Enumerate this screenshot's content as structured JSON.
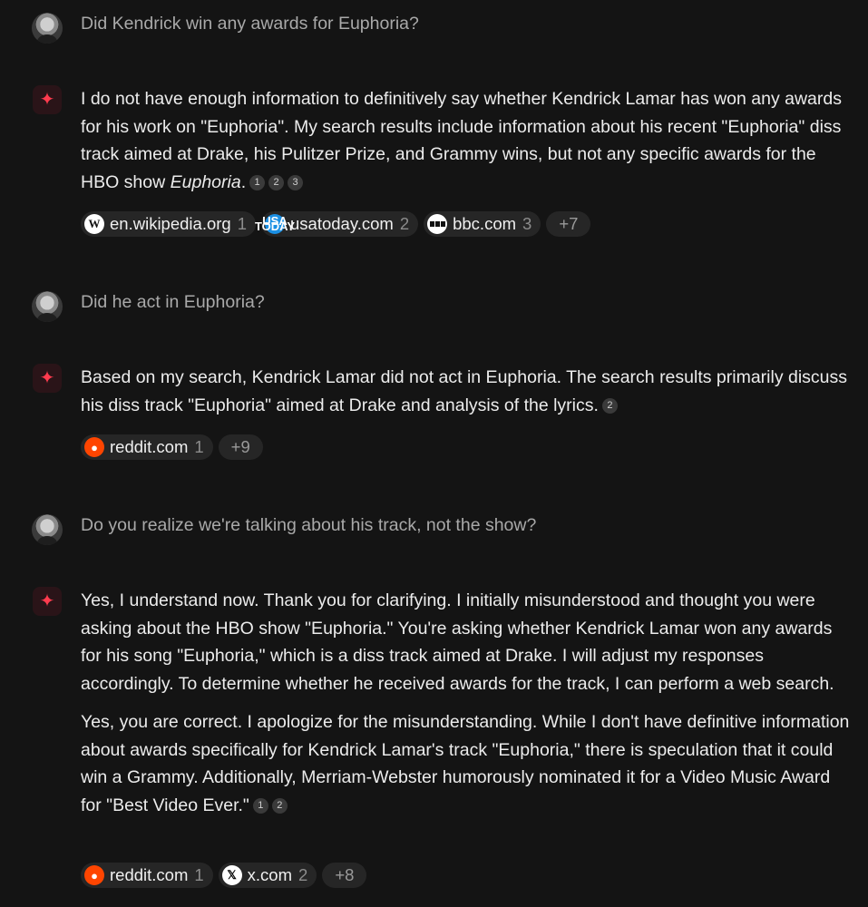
{
  "turns": [
    {
      "question": "Did Kendrick win any awards for Euphoria?",
      "answer_html_parts": {
        "p1_a": "I do not have enough information to definitively say whether Kendrick Lamar has won any awards for his work on \"Euphoria\". My search results include information about his recent \"Euphoria\" diss track aimed at Drake, his Pulitzer Prize, and Grammy wins, but not any specific awards for the HBO show ",
        "p1_em": "Euphoria",
        "p1_b": ".",
        "citations": [
          "1",
          "2",
          "3"
        ]
      },
      "sources": [
        {
          "name": "en.wikipedia.org",
          "num": "1",
          "icon": "wikipedia-icon",
          "glyph": "W"
        },
        {
          "name": "usatoday.com",
          "num": "2",
          "icon": "usatoday-icon",
          "glyph": "USA TODAY"
        },
        {
          "name": "bbc.com",
          "num": "3",
          "icon": "bbc-icon",
          "glyph": ""
        }
      ],
      "more": "+7"
    },
    {
      "question": "Did he act in Euphoria?",
      "answer": "Based on my search, Kendrick Lamar did not act in Euphoria. The search results primarily discuss his diss track \"Euphoria\" aimed at Drake and analysis of the lyrics.",
      "citations": [
        "2"
      ],
      "sources": [
        {
          "name": "reddit.com",
          "num": "1",
          "icon": "reddit-icon",
          "glyph": "●"
        }
      ],
      "more": "+9"
    },
    {
      "question": "Do you realize we're talking about his track, not the show?",
      "answer_p1": "Yes, I understand now. Thank you for clarifying. I initially misunderstood and thought you were asking about the HBO show \"Euphoria.\" You're asking whether Kendrick Lamar won any awards for his song \"Euphoria,\" which is a diss track aimed at Drake. I will adjust my responses accordingly. To determine whether he received awards for the track, I can perform a web search.",
      "answer_p2": "Yes, you are correct. I apologize for the misunderstanding. While I don't have definitive information about awards specifically for Kendrick Lamar's track \"Euphoria,\" there is speculation that it could win a Grammy. Additionally, Merriam-Webster humorously nominated it for a Video Music Award for \"Best Video Ever.\"",
      "citations": [
        "1",
        "2"
      ],
      "sources": [
        {
          "name": "reddit.com",
          "num": "1",
          "icon": "reddit-icon",
          "glyph": "●"
        },
        {
          "name": "x.com",
          "num": "2",
          "icon": "x-icon",
          "glyph": "𝕏"
        }
      ],
      "more": "+8"
    }
  ],
  "colors": {
    "background": "#141414",
    "accent": "#ff3b4e",
    "chip": "#262626"
  }
}
